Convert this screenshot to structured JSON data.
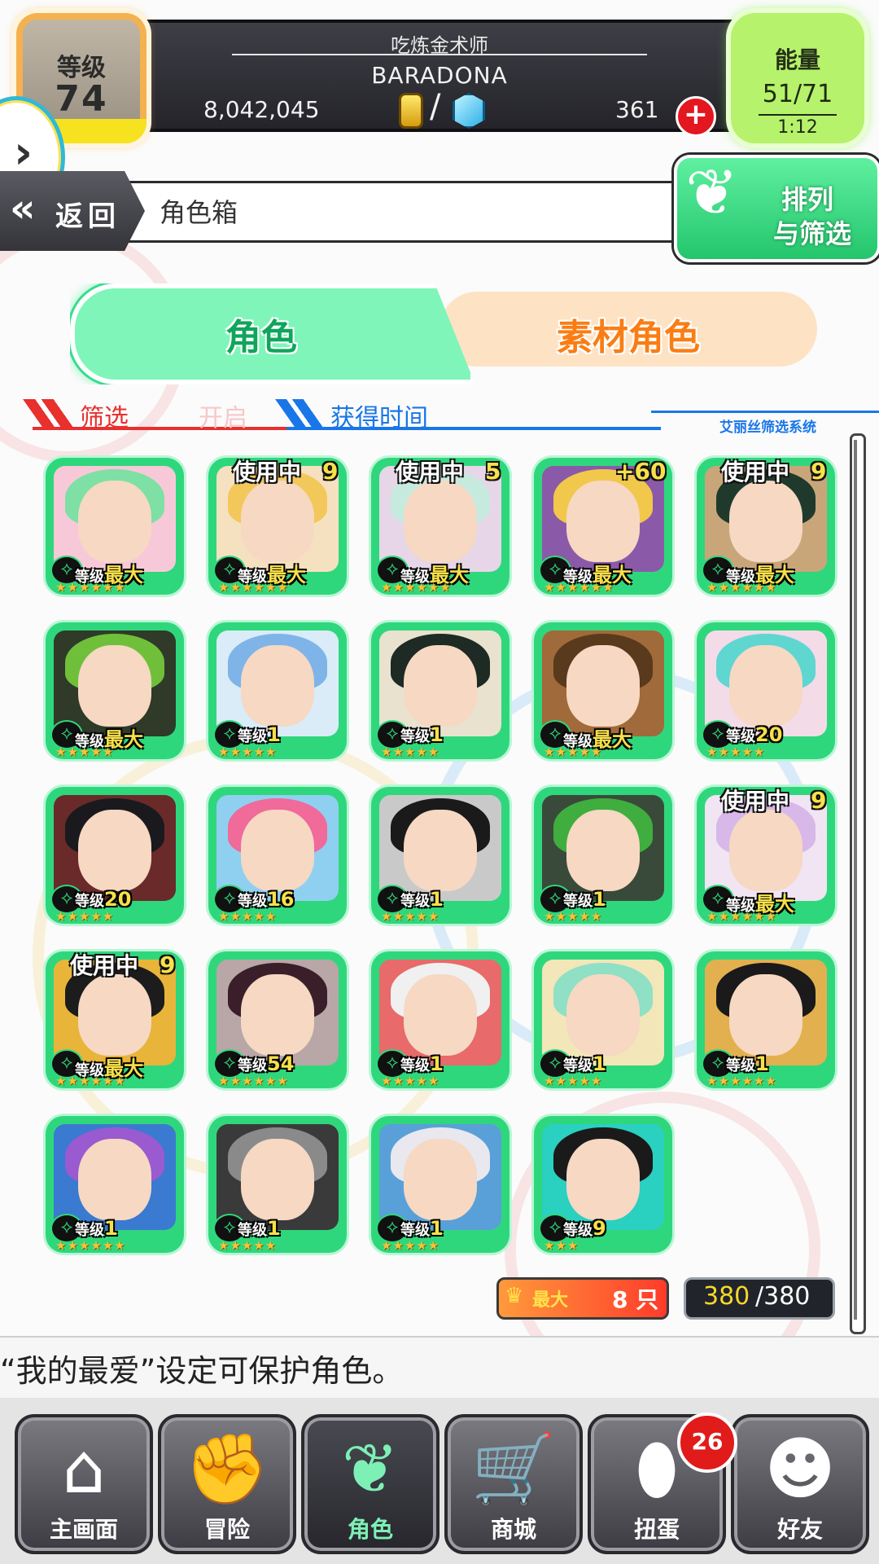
{
  "status": {
    "level_label": "等级",
    "level_value": "74",
    "rank_title": "吃炼金术师",
    "player_name": "BARADONA",
    "gold": "8,042,045",
    "slash": "/",
    "gems": "361",
    "plus_symbol": "+",
    "energy_label": "能量",
    "energy_value": "51/71",
    "energy_timer": "1:12",
    "side_arrow": "›"
  },
  "header": {
    "back_label": "返回",
    "page_title": "角色箱",
    "sort_filter_line1": "排列",
    "sort_filter_line2": "与筛选"
  },
  "tabs": {
    "active": "角色",
    "inactive": "素材角色"
  },
  "filter": {
    "filter_label": "筛选",
    "filter_state": "开启",
    "sort_order": "获得时间",
    "system_label": "艾丽丝筛选系统"
  },
  "characters": [
    {
      "badge": "",
      "extra": "",
      "level_prefix": "等级",
      "level": "最大",
      "stars": "★★★★★★",
      "hair": "#7ee0a4",
      "bg": "#f7c9d8"
    },
    {
      "badge": "使用中",
      "extra": "9",
      "level_prefix": "等级",
      "level": "最大",
      "stars": "★★★★★★",
      "hair": "#f3c85a",
      "bg": "#f5e1c0"
    },
    {
      "badge": "使用中",
      "extra": "5",
      "level_prefix": "等级",
      "level": "最大",
      "stars": "★★★★★★",
      "hair": "#c7eadf",
      "bg": "#e6d6e8"
    },
    {
      "badge": "",
      "extra": "+60",
      "level_prefix": "等级",
      "level": "最大",
      "stars": "★★★★★★",
      "hair": "#f1c84b",
      "bg": "#8a5aa8"
    },
    {
      "badge": "使用中",
      "extra": "9",
      "level_prefix": "等级",
      "level": "最大",
      "stars": "★★★★★★",
      "hair": "#1f3a2c",
      "bg": "#c9a679"
    },
    {
      "badge": "",
      "extra": "",
      "level_prefix": "等级",
      "level": "最大",
      "stars": "★★★★★",
      "hair": "#6fbf3b",
      "bg": "#2f3a28"
    },
    {
      "badge": "",
      "extra": "",
      "level_prefix": "等级",
      "level": "1",
      "stars": "★★★★★",
      "hair": "#7fb4e8",
      "bg": "#d9ecf7"
    },
    {
      "badge": "",
      "extra": "",
      "level_prefix": "等级",
      "level": "1",
      "stars": "★★★★★",
      "hair": "#1e2a24",
      "bg": "#e9e2cf"
    },
    {
      "badge": "",
      "extra": "",
      "level_prefix": "等级",
      "level": "最大",
      "stars": "★★★★★",
      "hair": "#5a3a1c",
      "bg": "#a06a3a"
    },
    {
      "badge": "",
      "extra": "",
      "level_prefix": "等级",
      "level": "20",
      "stars": "★★★★★",
      "hair": "#5fd6d0",
      "bg": "#f4dbe8"
    },
    {
      "badge": "",
      "extra": "",
      "level_prefix": "等级",
      "level": "20",
      "stars": "★★★★★",
      "hair": "#1a1a1e",
      "bg": "#6a2a2a"
    },
    {
      "badge": "",
      "extra": "",
      "level_prefix": "等级",
      "level": "16",
      "stars": "★★★★★",
      "hair": "#f06a9a",
      "bg": "#8fd0f0"
    },
    {
      "badge": "",
      "extra": "",
      "level_prefix": "等级",
      "level": "1",
      "stars": "★★★★★",
      "hair": "#1a1a1a",
      "bg": "#c9c9c9"
    },
    {
      "badge": "",
      "extra": "",
      "level_prefix": "等级",
      "level": "1",
      "stars": "★★★★★",
      "hair": "#3fae3f",
      "bg": "#3a4a3a"
    },
    {
      "badge": "使用中",
      "extra": "9",
      "level_prefix": "等级",
      "level": "最大",
      "stars": "★★★★★★",
      "hair": "#d8b8e8",
      "bg": "#f1e4f3"
    },
    {
      "badge": "使用中",
      "extra": "9",
      "level_prefix": "等级",
      "level": "最大",
      "stars": "★★★★★★",
      "hair": "#1c1c1c",
      "bg": "#e9b43a"
    },
    {
      "badge": "",
      "extra": "",
      "level_prefix": "等级",
      "level": "54",
      "stars": "★★★★★★",
      "hair": "#3a1f2a",
      "bg": "#b9a6a6"
    },
    {
      "badge": "",
      "extra": "",
      "level_prefix": "等级",
      "level": "1",
      "stars": "★★★★★",
      "hair": "#f0f0f0",
      "bg": "#e86a6a"
    },
    {
      "badge": "",
      "extra": "",
      "level_prefix": "等级",
      "level": "1",
      "stars": "★★★★★",
      "hair": "#8fe0c4",
      "bg": "#f3e6b8"
    },
    {
      "badge": "",
      "extra": "",
      "level_prefix": "等级",
      "level": "1",
      "stars": "★★★★★★",
      "hair": "#1a1a1a",
      "bg": "#e3b050"
    },
    {
      "badge": "",
      "extra": "",
      "level_prefix": "等级",
      "level": "1",
      "stars": "★★★★★★",
      "hair": "#9a5ad0",
      "bg": "#3a7ad0"
    },
    {
      "badge": "",
      "extra": "",
      "level_prefix": "等级",
      "level": "1",
      "stars": "★★★★★",
      "hair": "#8a8a8a",
      "bg": "#3a3a3a"
    },
    {
      "badge": "",
      "extra": "",
      "level_prefix": "等级",
      "level": "1",
      "stars": "★★★★★",
      "hair": "#e8e8ee",
      "bg": "#5aa0d8"
    },
    {
      "badge": "",
      "extra": "",
      "level_prefix": "等级",
      "level": "9",
      "stars": "★★★",
      "hair": "#1a1a1a",
      "bg": "#2ad0c0"
    }
  ],
  "capacity": {
    "favorites_label": "最大",
    "favorites_count": "8 只",
    "box_used": "380",
    "box_total": "/380"
  },
  "message": "“我的最爱”设定可保护角色。",
  "nav": [
    {
      "label": "主画面",
      "icon": "⌂"
    },
    {
      "label": "冒险",
      "icon": "✊"
    },
    {
      "label": "角色",
      "icon": "❦"
    },
    {
      "label": "商城",
      "icon": "🛒"
    },
    {
      "label": "扭蛋",
      "icon": "⬮"
    },
    {
      "label": "好友",
      "icon": "☻"
    }
  ],
  "gacha_notification": "26",
  "colors": {
    "accent_green": "#2fd77c",
    "tab_orange": "#fa7d14",
    "filter_red": "#e8302d",
    "sort_blue": "#1976e8"
  }
}
